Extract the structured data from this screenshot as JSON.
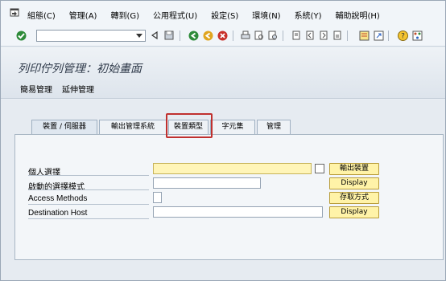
{
  "menu": {
    "items": [
      "組態(C)",
      "管理(A)",
      "轉到(G)",
      "公用程式(U)",
      "設定(S)",
      "環境(N)",
      "系統(Y)",
      "輔助說明(H)"
    ]
  },
  "toolbar": {
    "command_value": "",
    "icons": [
      "enter-checkmark",
      "back-triangle",
      "save-floppy",
      "back-green",
      "exit-yellow",
      "cancel-red",
      "print",
      "find",
      "find-next",
      "first-page",
      "previous-page",
      "next-page",
      "last-page",
      "create-session",
      "shortcut",
      "help",
      "customize-layout"
    ]
  },
  "title": {
    "text": "列印佇列管理：初始畫面",
    "links": [
      "簡易管理",
      "延伸管理"
    ]
  },
  "tabs": [
    "裝置 / 伺服器",
    "輸出管理系統",
    "裝置類型",
    "字元集",
    "管理"
  ],
  "fields": [
    {
      "label": "個人選擇",
      "value": "",
      "button": "輸出裝置"
    },
    {
      "label": "啟動的選擇模式",
      "value": "",
      "button": "Display"
    },
    {
      "label": "Access Methods",
      "value": "",
      "button": "存取方式"
    },
    {
      "label": "Destination Host",
      "value": "",
      "button": "Display"
    }
  ],
  "colors": {
    "highlight": "#c0302e",
    "required_field": "#fff5b8",
    "button": "#fff3a8"
  }
}
